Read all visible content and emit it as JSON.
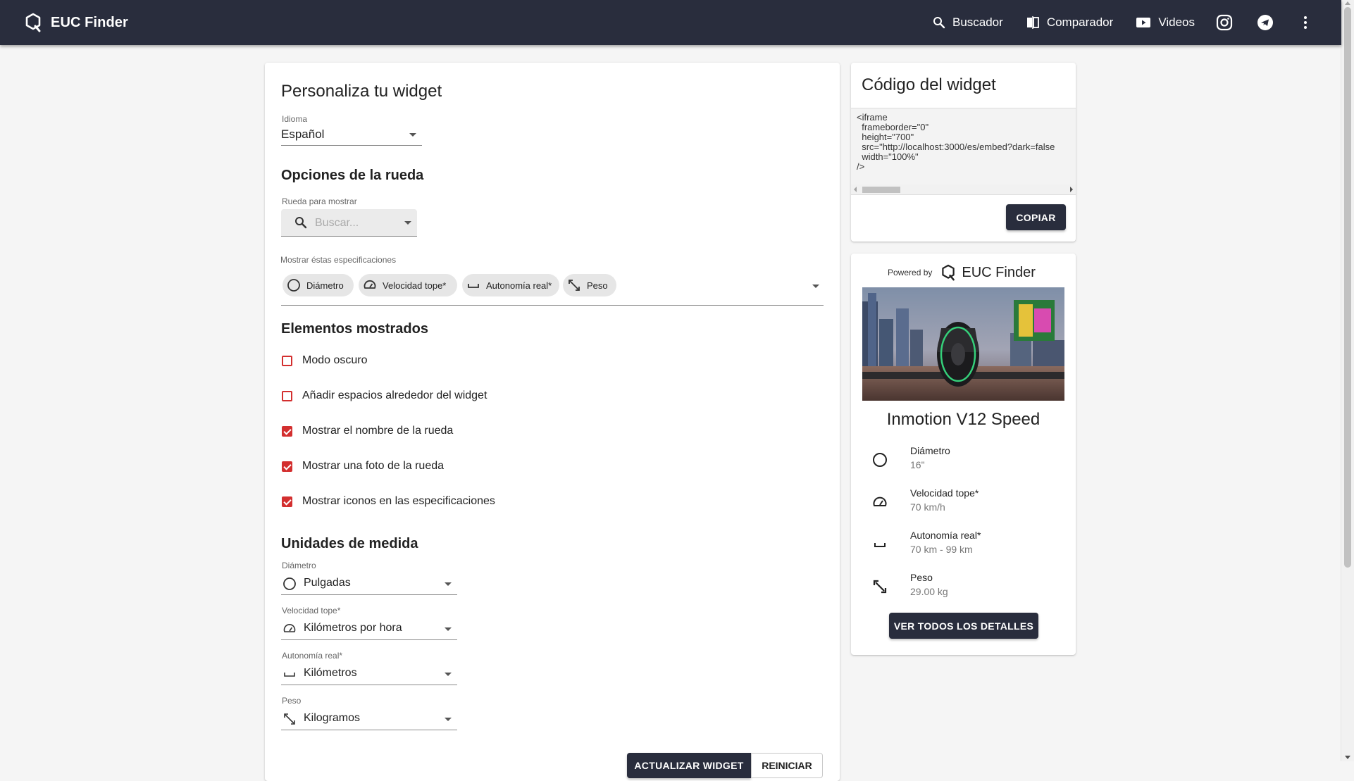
{
  "appbar": {
    "brand": "EUC Finder",
    "nav": [
      {
        "label": "Buscador",
        "icon": "search-icon"
      },
      {
        "label": "Comparador",
        "icon": "compare-icon"
      },
      {
        "label": "Videos",
        "icon": "youtube-icon"
      }
    ],
    "icons": [
      "instagram-icon",
      "telegram-icon",
      "more-vert-icon"
    ]
  },
  "customize": {
    "title": "Personaliza tu widget",
    "language": {
      "label": "Idioma",
      "value": "Español"
    },
    "wheel_options": {
      "title": "Opciones de la rueda",
      "wheel_label": "Rueda para mostrar",
      "wheel_placeholder": "Buscar...",
      "specs_label": "Mostrar éstas especificaciones",
      "chips": [
        "Diámetro",
        "Velocidad tope*",
        "Autonomía real*",
        "Peso"
      ]
    },
    "elements": {
      "title": "Elementos mostrados",
      "items": [
        {
          "label": "Modo oscuro",
          "checked": false
        },
        {
          "label": "Añadir espacios alrededor del widget",
          "checked": false
        },
        {
          "label": "Mostrar el nombre de la rueda",
          "checked": true
        },
        {
          "label": "Mostrar una foto de la rueda",
          "checked": true
        },
        {
          "label": "Mostrar iconos en las especificaciones",
          "checked": true
        }
      ]
    },
    "units": {
      "title": "Unidades de medida",
      "fields": [
        {
          "label": "Diámetro",
          "value": "Pulgadas",
          "icon": "circle-icon"
        },
        {
          "label": "Velocidad tope*",
          "value": "Kilómetros por hora",
          "icon": "speedometer-icon"
        },
        {
          "label": "Autonomía real*",
          "value": "Kilómetros",
          "icon": "range-icon"
        },
        {
          "label": "Peso",
          "value": "Kilogramos",
          "icon": "weight-icon"
        }
      ]
    },
    "buttons": {
      "update": "ACTUALIZAR WIDGET",
      "reset": "REINICIAR"
    }
  },
  "code": {
    "title": "Código del widget",
    "snippet": "<iframe\n  frameborder=\"0\"\n  height=\"700\"\n  src=\"http://localhost:3000/es/embed?dark=false\n  width=\"100%\"\n/>",
    "copy": "COPIAR"
  },
  "preview": {
    "powered_by": "Powered by",
    "brand": "EUC Finder",
    "wheel_name": "Inmotion V12 Speed",
    "specs": [
      {
        "label": "Diámetro",
        "value": "16\"",
        "icon": "circle-icon"
      },
      {
        "label": "Velocidad tope*",
        "value": "70 km/h",
        "icon": "speedometer-icon"
      },
      {
        "label": "Autonomía real*",
        "value": "70 km - 99 km",
        "icon": "range-icon"
      },
      {
        "label": "Peso",
        "value": "29.00 kg",
        "icon": "weight-icon"
      }
    ],
    "details_button": "VER TODOS LOS DETALLES"
  },
  "colors": {
    "appbar": "#292d3d",
    "accent_checkbox": "#d32f2f",
    "background": "#f5f5f5"
  }
}
